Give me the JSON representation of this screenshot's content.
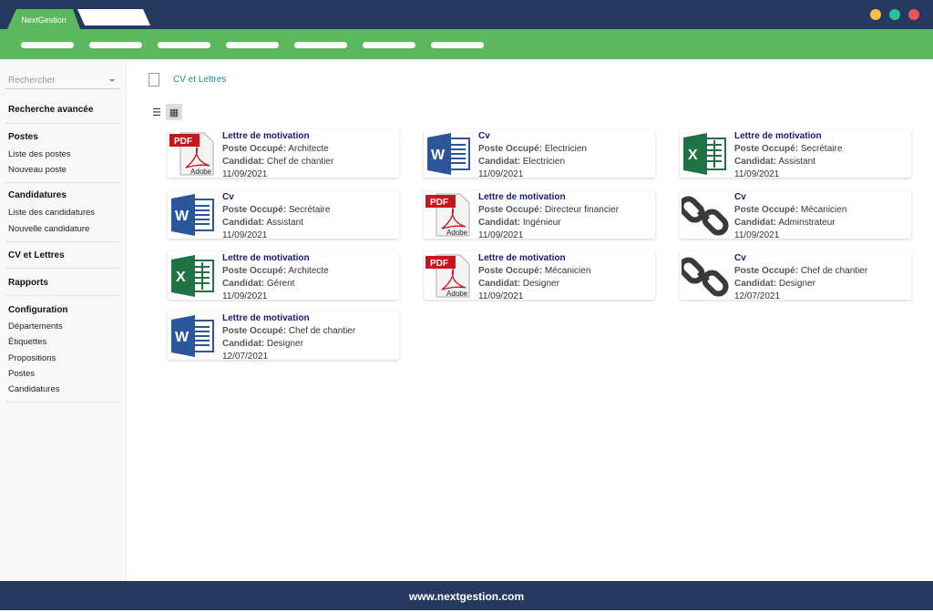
{
  "app": {
    "tab": "NextGestion",
    "footer": "www.nextgestion.com"
  },
  "sidebar": {
    "search_placeholder": "Rechercher",
    "advanced": "Recherche avancée",
    "sections": [
      {
        "title": "Postes",
        "items": [
          "Liste des postes",
          "Nouveau poste"
        ]
      },
      {
        "title": "Candidatures",
        "items": [
          "Liste des candidatures",
          "Nouvelle candidature"
        ]
      },
      {
        "title": "CV et Lettres",
        "items": []
      },
      {
        "title": "Rapports",
        "items": []
      },
      {
        "title": "Configuration",
        "items": [
          "Départements",
          "Étiquettes",
          "Propositions",
          "Postes",
          "Candidatures"
        ]
      }
    ]
  },
  "breadcrumb": "CV et Lettres",
  "labels": {
    "poste": "Poste Occupé:",
    "candidat": "Candidat:"
  },
  "cards": [
    {
      "icon": "pdf",
      "title": "Lettre de motivation",
      "poste": "Architecte",
      "candidat": "Chef de chantier",
      "date": "11/09/2021"
    },
    {
      "icon": "word",
      "title": "Cv",
      "poste": "Electricien",
      "candidat": "Electricien",
      "date": "11/09/2021"
    },
    {
      "icon": "excel",
      "title": "Lettre de motivation",
      "poste": "Secrétaire",
      "candidat": "Assistant",
      "date": "11/09/2021"
    },
    {
      "icon": "word",
      "title": "Cv",
      "poste": "Secrétaire",
      "candidat": "Assistant",
      "date": "11/09/2021"
    },
    {
      "icon": "pdf",
      "title": "Lettre de motivation",
      "poste": "Directeur financier",
      "candidat": "Ingénieur",
      "date": "11/09/2021"
    },
    {
      "icon": "link",
      "title": "Cv",
      "poste": "Mécanicien",
      "candidat": "Adminstrateur",
      "date": "11/09/2021"
    },
    {
      "icon": "excel",
      "title": "Lettre de motivation",
      "poste": "Architecte",
      "candidat": "Gérent",
      "date": "11/09/2021"
    },
    {
      "icon": "pdf",
      "title": "Lettre de motivation",
      "poste": "Mécanicien",
      "candidat": "Designer",
      "date": "11/09/2021"
    },
    {
      "icon": "link",
      "title": "Cv",
      "poste": "Chef de chantier",
      "candidat": "Designer",
      "date": "12/07/2021"
    },
    {
      "icon": "word",
      "title": "Lettre de motivation",
      "poste": "Chef de chantier",
      "candidat": "Designer",
      "date": "12/07/2021"
    }
  ]
}
